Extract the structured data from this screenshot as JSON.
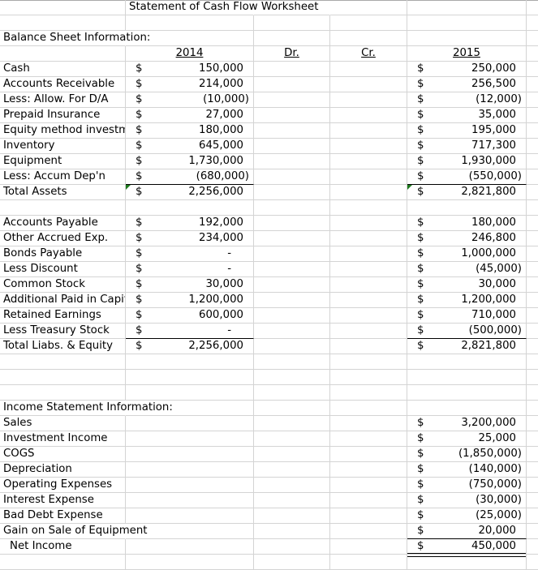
{
  "title": "Statement of Cash Flow Worksheet",
  "balance_sheet": {
    "heading": "Balance Sheet Information:",
    "col_headers": {
      "y2014": "2014",
      "dr": "Dr.",
      "cr": "Cr.",
      "y2015": "2015"
    },
    "currency": "$",
    "assets": [
      {
        "label": "Cash",
        "y2014": "150,000",
        "y2015": "250,000"
      },
      {
        "label": "Accounts Receivable",
        "y2014": "214,000",
        "y2015": "256,500"
      },
      {
        "label": "Less:  Allow. For D/A",
        "y2014": "(10,000)",
        "y2015": "(12,000)"
      },
      {
        "label": "Prepaid Insurance",
        "y2014": "27,000",
        "y2015": "35,000"
      },
      {
        "label": "Equity method investment",
        "y2014": "180,000",
        "y2015": "195,000"
      },
      {
        "label": "Inventory",
        "y2014": "645,000",
        "y2015": "717,300"
      },
      {
        "label": "Equipment",
        "y2014": "1,730,000",
        "y2015": "1,930,000"
      },
      {
        "label": "Less:  Accum Dep'n",
        "y2014": "(680,000)",
        "y2015": "(550,000)"
      }
    ],
    "total_assets": {
      "label": "Total Assets",
      "y2014": "2,256,000",
      "y2015": "2,821,800"
    },
    "liabilities_equity": [
      {
        "label": "Accounts Payable",
        "y2014": "192,000",
        "y2015": "180,000"
      },
      {
        "label": "Other Accrued Exp.",
        "y2014": "234,000",
        "y2015": "246,800"
      },
      {
        "label": "Bonds Payable",
        "y2014": "-",
        "y2015": "1,000,000"
      },
      {
        "label": "Less Discount",
        "y2014": "-",
        "y2015": "(45,000)"
      },
      {
        "label": "Common Stock",
        "y2014": "30,000",
        "y2015": "30,000"
      },
      {
        "label": "Additional Paid in Capital",
        "y2014": "1,200,000",
        "y2015": "1,200,000"
      },
      {
        "label": "Retained Earnings",
        "y2014": "600,000",
        "y2015": "710,000"
      },
      {
        "label": "Less Treasury Stock",
        "y2014": "-",
        "y2015": "(500,000)"
      }
    ],
    "total_liabs_equity": {
      "label": "Total Liabs. & Equity",
      "y2014": "2,256,000",
      "y2015": "2,821,800"
    }
  },
  "income_statement": {
    "heading": "Income Statement Information:",
    "items": [
      {
        "label": "Sales",
        "amount": "3,200,000"
      },
      {
        "label": "Investment Income",
        "amount": "25,000"
      },
      {
        "label": "COGS",
        "amount": "(1,850,000)"
      },
      {
        "label": "Depreciation",
        "amount": "(140,000)"
      },
      {
        "label": "Operating Expenses",
        "amount": "(750,000)"
      },
      {
        "label": "Interest Expense",
        "amount": "(30,000)"
      },
      {
        "label": "Bad Debt Expense",
        "amount": "(25,000)"
      },
      {
        "label": "Gain on Sale of Equipment",
        "amount": "20,000"
      }
    ],
    "net_income": {
      "label": "Net Income",
      "amount": "450,000"
    }
  }
}
